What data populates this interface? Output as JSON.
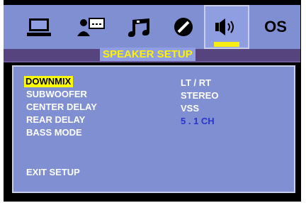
{
  "tabs": [
    {
      "name": "display-setup",
      "icon": "monitor-icon"
    },
    {
      "name": "video-setup",
      "icon": "video-setup-icon"
    },
    {
      "name": "audio-setup",
      "icon": "music-note-icon"
    },
    {
      "name": "rating-setup",
      "icon": "disc-icon"
    },
    {
      "name": "speaker-setup",
      "icon": "speaker-icon",
      "active": true
    },
    {
      "name": "os-setup",
      "label": "OS"
    }
  ],
  "title": "SPEAKER SETUP",
  "menu": {
    "items": [
      "DOWNMIX",
      "SUBWOOFER",
      "CENTER DELAY",
      "REAR DELAY",
      "BASS MODE",
      "EXIT SETUP"
    ],
    "selected": "DOWNMIX",
    "options": [
      "LT / RT",
      "STEREO",
      "VSS",
      "5 . 1 CH"
    ],
    "highlighted_option": "5 . 1 CH"
  },
  "colors": {
    "accent": "#f6ec16",
    "panel": "#7f8fd2",
    "title_bar": "#55447e",
    "selected_option": "#2a35c9"
  }
}
